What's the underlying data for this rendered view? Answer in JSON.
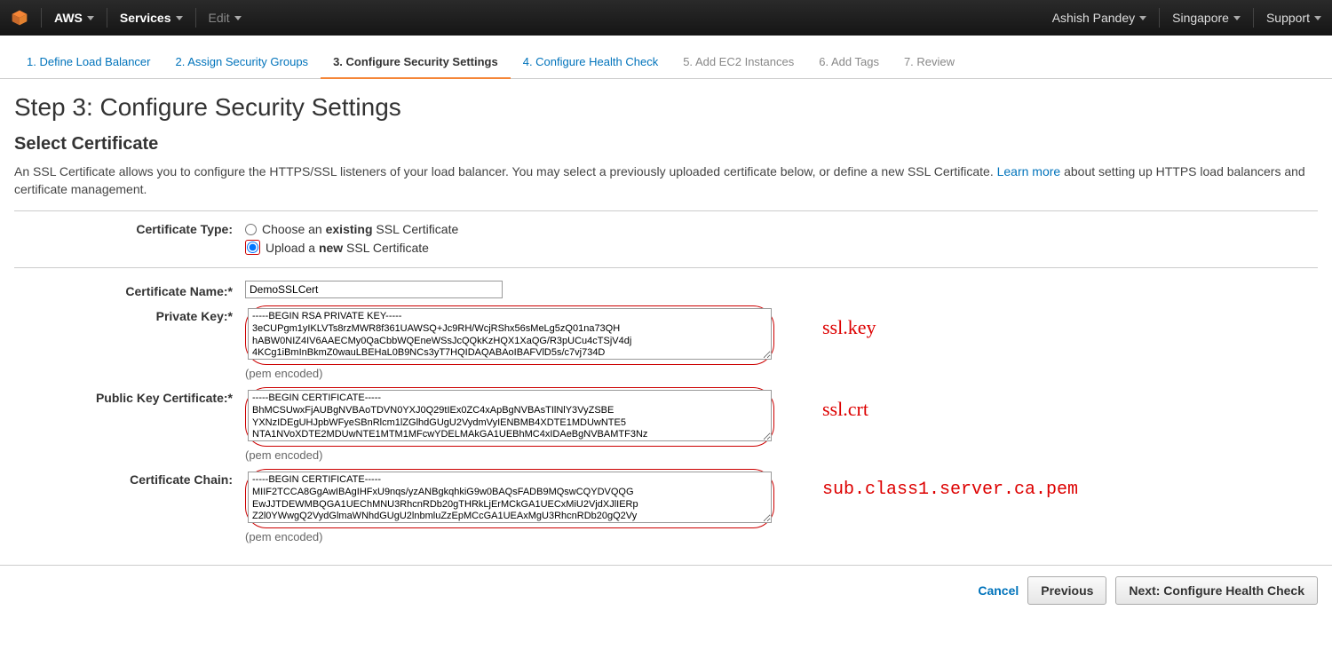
{
  "topbar": {
    "brand": "AWS",
    "services": "Services",
    "edit": "Edit",
    "user": "Ashish Pandey",
    "region": "Singapore",
    "support": "Support"
  },
  "wizard": {
    "steps": [
      {
        "label": "1. Define Load Balancer",
        "state": "link"
      },
      {
        "label": "2. Assign Security Groups",
        "state": "link"
      },
      {
        "label": "3. Configure Security Settings",
        "state": "active"
      },
      {
        "label": "4. Configure Health Check",
        "state": "link"
      },
      {
        "label": "5. Add EC2 Instances",
        "state": "disabled"
      },
      {
        "label": "6. Add Tags",
        "state": "disabled"
      },
      {
        "label": "7. Review",
        "state": "disabled"
      }
    ]
  },
  "page": {
    "title": "Step 3: Configure Security Settings",
    "subtitle": "Select Certificate",
    "desc_pre": "An SSL Certificate allows you to configure the HTTPS/SSL listeners of your load balancer. You may select a previously uploaded certificate below, or define a new SSL Certificate. ",
    "desc_link": "Learn more",
    "desc_post": " about setting up HTTPS load balancers and certificate management."
  },
  "cert_type": {
    "label": "Certificate Type:",
    "existing_pre": "Choose an ",
    "existing_bold": "existing",
    "existing_post": " SSL Certificate",
    "upload_pre": "Upload a ",
    "upload_bold": "new",
    "upload_post": " SSL Certificate",
    "selected": "upload"
  },
  "fields": {
    "cert_name": {
      "label": "Certificate Name:*",
      "value": "DemoSSLCert"
    },
    "private_key": {
      "label": "Private Key:*",
      "value": "-----BEGIN RSA PRIVATE KEY-----\n3eCUPgm1yIKLVTs8rzMWR8f361UAWSQ+Jc9RH/WcjRShx56sMeLg5zQ01na73QH\nhABW0NIZ4IV6AAECMy0QaCbbWQEneWSsJcQQkKzHQX1XaQG/R3pUCu4cTSjV4dj\n4KCg1iBmInBkmZ0wauLBEHaL0B9NCs3yT7HQIDAQABAoIBAFVlD5s/c7vj734D",
      "hint": "(pem encoded)",
      "annotation": "ssl.key"
    },
    "public_key": {
      "label": "Public Key Certificate:*",
      "value": "-----BEGIN CERTIFICATE-----\nBhMCSUwxFjAUBgNVBAoTDVN0YXJ0Q29tIEx0ZC4xApBgNVBAsTIlNlY3VyZSBE\nYXNzIDEgUHJpbWFyeSBnRlcm1lZGlhdGUgU2VydmVyIENBMB4XDTE1MDUwNTE5\nNTA1NVoXDTE2MDUwNTE1MTM1MFcwYDELMAkGA1UEBhMC4xIDAeBgNVBAMTF3Nz",
      "hint": "(pem encoded)",
      "annotation": "ssl.crt"
    },
    "cert_chain": {
      "label": "Certificate Chain:",
      "value": "-----BEGIN CERTIFICATE-----\nMIIF2TCCA8GgAwIBAgIHFxU9nqs/yzANBgkqhkiG9w0BAQsFADB9MQswCQYDVQQG\nEwJJTDEWMBQGA1UEChMNU3RhcnRDb20gTHRkLjErMCkGA1UECxMiU2VjdXJlIERp\nZ2l0YWwgQ2VydGlmaWNhdGUgU2lnbmluZzEpMCcGA1UEAxMgU3RhcnRDb20gQ2Vy",
      "hint": "(pem encoded)",
      "annotation": "sub.class1.server.ca.pem"
    }
  },
  "footer": {
    "cancel": "Cancel",
    "previous": "Previous",
    "next": "Next: Configure Health Check"
  }
}
